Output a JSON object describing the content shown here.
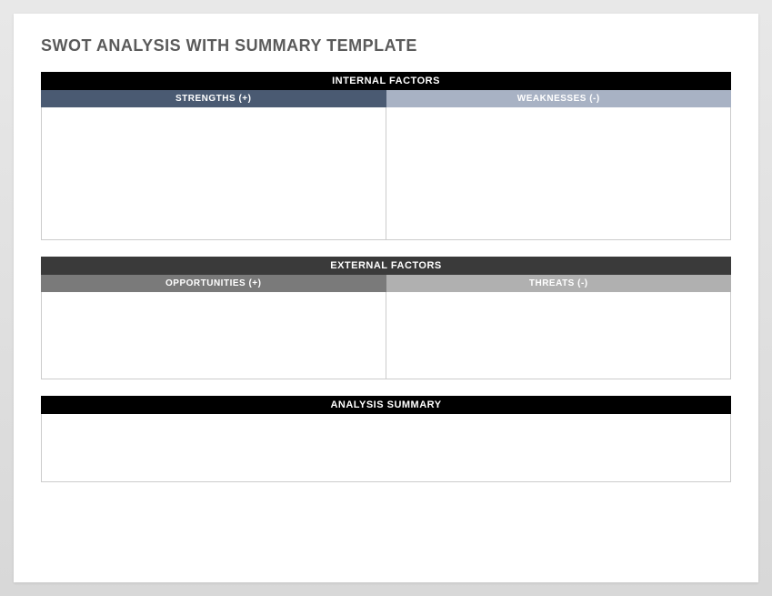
{
  "title": "SWOT ANALYSIS WITH SUMMARY TEMPLATE",
  "internal": {
    "header": "INTERNAL FACTORS",
    "strengths": {
      "label": "STRENGTHS (+)",
      "content": ""
    },
    "weaknesses": {
      "label": "WEAKNESSES (-)",
      "content": ""
    }
  },
  "external": {
    "header": "EXTERNAL FACTORS",
    "opportunities": {
      "label": "OPPORTUNITIES (+)",
      "content": ""
    },
    "threats": {
      "label": "THREATS (-)",
      "content": ""
    }
  },
  "summary": {
    "header": "ANALYSIS SUMMARY",
    "content": ""
  }
}
